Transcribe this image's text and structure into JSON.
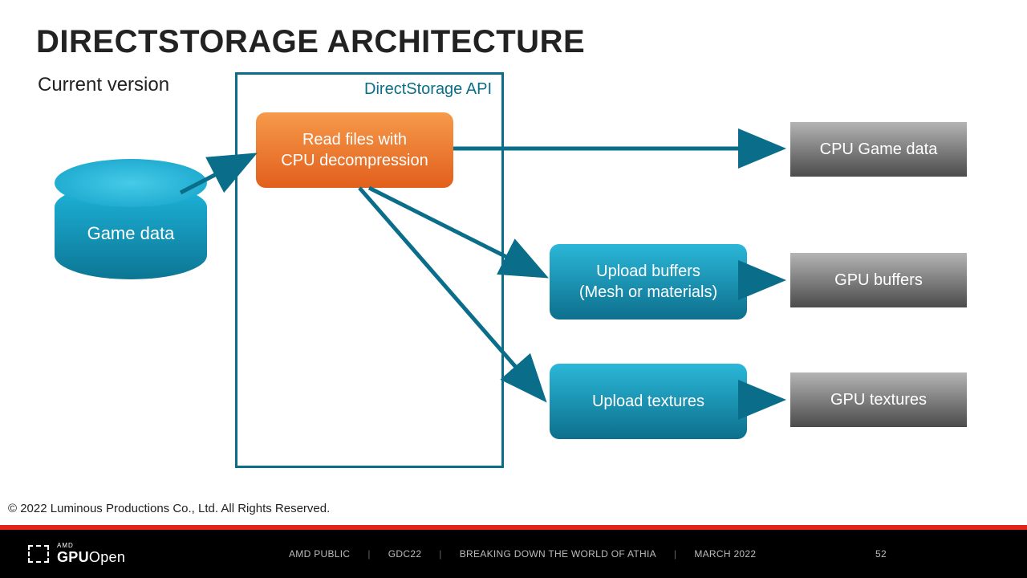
{
  "title": "DIRECTSTORAGE ARCHITECTURE",
  "subtitle": "Current version",
  "api_label": "DirectStorage API",
  "cylinder_label": "Game data",
  "blocks": {
    "read_l1": "Read files with",
    "read_l2": "CPU decompression",
    "upload_buf_l1": "Upload buffers",
    "upload_buf_l2": "(Mesh or materials)",
    "upload_tex": "Upload textures",
    "cpu_data": "CPU Game data",
    "gpu_buf": "GPU buffers",
    "gpu_tex": "GPU textures"
  },
  "copyright": "© 2022 Luminous Productions Co., Ltd. All Rights Reserved.",
  "footer": {
    "brand_top": "AMD",
    "brand_gpu": "GPU",
    "brand_open": "Open",
    "classification": "AMD PUBLIC",
    "event": "GDC22",
    "talk": "BREAKING DOWN THE WORLD OF ATHIA",
    "date": "MARCH 2022",
    "page": "52"
  },
  "colors": {
    "outline": "#0a6e8a",
    "arrow": "#0a6e8a"
  }
}
